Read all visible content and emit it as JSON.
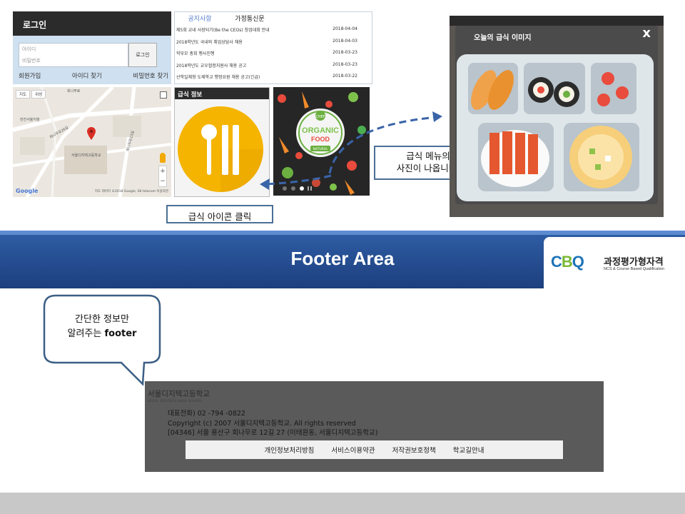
{
  "login": {
    "title": "로그인",
    "id_placeholder": "아이디",
    "pw_placeholder": "비밀번호",
    "button": "로그인",
    "links": [
      "회원가입",
      "아이디 찾기",
      "비밀번호 찾기"
    ]
  },
  "map": {
    "tabs": [
      "지도",
      "위성"
    ],
    "labels": [
      "회나무로",
      "서울디지텍고등학교",
      "한진서울지점",
      "회나무로26길",
      "회나무로13길"
    ],
    "brand": "Google",
    "copyright": "지도 데이터 ©2018 Google, SK telecom  이용약관"
  },
  "notices": {
    "tabs": [
      "공지사항",
      "가정통신문"
    ],
    "rows": [
      {
        "title": "제5회 교내 사장되기(Be the CEOs) 창업대회 안내",
        "date": "2018-04-04"
      },
      {
        "title": "2018학년도 국내외 취업상담사 채용",
        "date": "2018-04-03"
      },
      {
        "title": "학부모 총회 행사진행",
        "date": "2018-03-23"
      },
      {
        "title": "2018학년도 교우협정지원사 채용 공고",
        "date": "2018-03-23"
      },
      {
        "title": "산학일체형 도제학교 행정요원 채용 공고(긴급)",
        "date": "2018-03-22"
      }
    ]
  },
  "meal": {
    "title": "급식 정보"
  },
  "organic": {
    "badge_top": "CHEF",
    "word1": "ORGANIC",
    "word2": "FOOD",
    "badge_bottom": "NATURAL"
  },
  "callouts": {
    "photo_line1": "급식 메뉴의",
    "photo_line2": "사진이 나옵니다.",
    "click": "급식 아이콘 클릭"
  },
  "meal_window": {
    "title": "오늘의 급식 이미지",
    "close": "x"
  },
  "footer_banner": {
    "title": "Footer Area"
  },
  "cbq": {
    "logo_c": "C",
    "logo_b": "B",
    "logo_q": "Q",
    "name": "과정평가형자격",
    "sub": "NCS & Course Based Qualification"
  },
  "bubble": {
    "line1": "간단한 정보만",
    "line2_prefix": "알려주는 ",
    "line2_bold": "footer"
  },
  "school_footer": {
    "name": "서울디지텍고등학교",
    "name_en": "SEOUL DIGITECH HIGH SCHOOL",
    "phone": "대표전화) 02 -794 -0822",
    "copyright": "Copyright (c) 2007 서울디지텍고등학교. All rights reserved",
    "address": "[04346] 서울 용산구 회나무로 12길 27 (이태원동, 서울디지텍고등학교)",
    "links": [
      "개인정보처리방침",
      "서비스이용약관",
      "저작권보호정책",
      "학교길안내"
    ]
  },
  "colors": {
    "banner": "#2f5ea6",
    "callout_border": "#4b6f96",
    "arrow": "#3a64a8",
    "meal_icon": "#f5b400"
  }
}
